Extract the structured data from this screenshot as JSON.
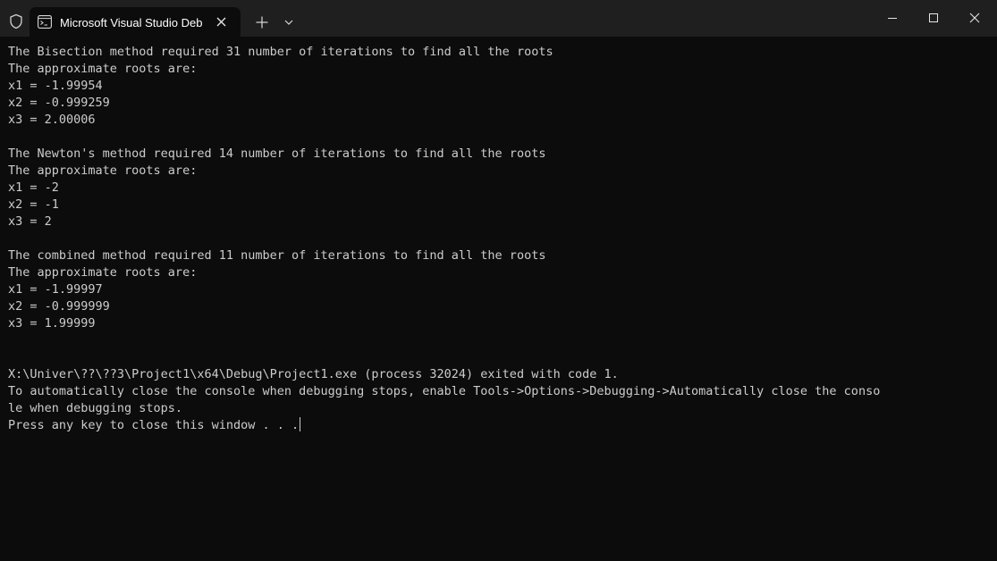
{
  "window": {
    "tab_title": "Microsoft Visual Studio Debug Console"
  },
  "console": {
    "lines": [
      "The Bisection method required 31 number of iterations to find all the roots",
      "The approximate roots are:",
      "x1 = -1.99954",
      "x2 = -0.999259",
      "x3 = 2.00006",
      "",
      "The Newton's method required 14 number of iterations to find all the roots",
      "The approximate roots are:",
      "x1 = -2",
      "x2 = -1",
      "x3 = 2",
      "",
      "The combined method required 11 number of iterations to find all the roots",
      "The approximate roots are:",
      "x1 = -1.99997",
      "x2 = -0.999999",
      "x3 = 1.99999",
      "",
      "",
      "X:\\Univer\\??\\??3\\Project1\\x64\\Debug\\Project1.exe (process 32024) exited with code 1.",
      "To automatically close the console when debugging stops, enable Tools->Options->Debugging->Automatically close the conso",
      "le when debugging stops.",
      "Press any key to close this window . . ."
    ]
  },
  "colors": {
    "background": "#0c0c0c",
    "titlebar": "#1f1f1f",
    "text": "#cccccc"
  },
  "icons": {
    "shield": "shield-icon",
    "tab": "console-app-icon",
    "tab_close": "close-icon",
    "new_tab": "plus-icon",
    "dropdown": "chevron-down-icon",
    "minimize": "minimize-icon",
    "maximize": "maximize-icon",
    "close": "close-icon"
  }
}
